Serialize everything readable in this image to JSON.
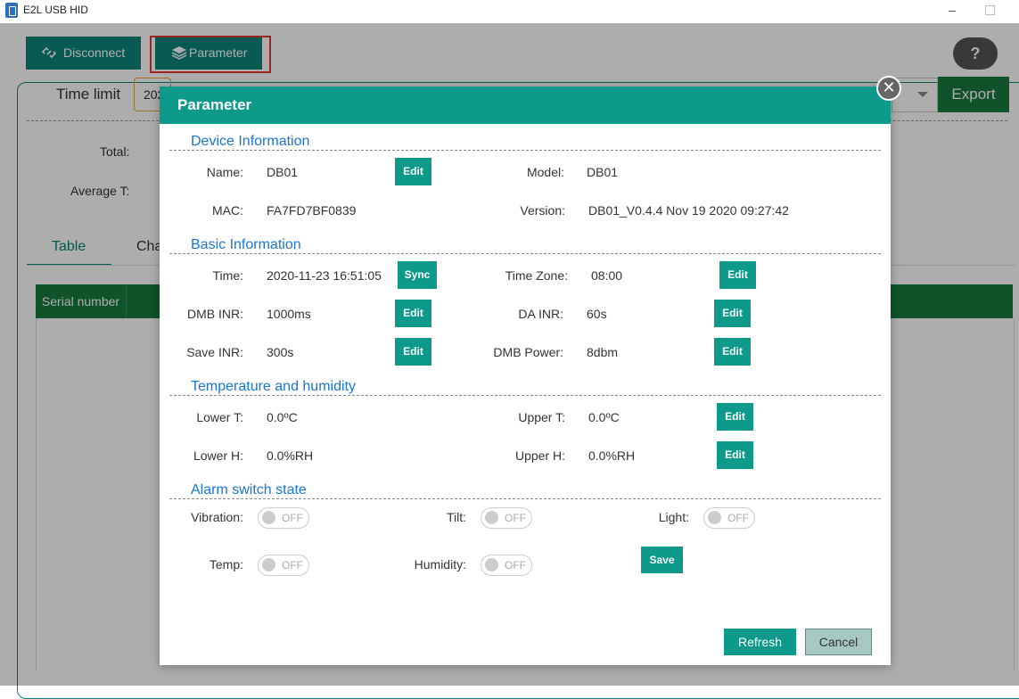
{
  "window": {
    "title": "E2L USB HID",
    "minimize": "–"
  },
  "toolbar": {
    "disconnect_label": "Disconnect",
    "parameter_label": "Parameter",
    "help_label": "?"
  },
  "filter": {
    "time_limit_label": "Time limit",
    "time_value": "202",
    "export_label": "Export"
  },
  "stats": {
    "total_label": "Total:",
    "average_label": "Average T:"
  },
  "tabs": [
    {
      "label": "Table"
    },
    {
      "label": "Cha"
    }
  ],
  "table": {
    "columns": [
      "Serial number"
    ]
  },
  "modal": {
    "title": "Parameter",
    "close_glyph": "✕",
    "device_info": {
      "title": "Device Information",
      "name_label": "Name:",
      "name_value": "DB01",
      "model_label": "Model:",
      "model_value": "DB01",
      "mac_label": "MAC:",
      "mac_value": "FA7FD7BF0839",
      "version_label": "Version:",
      "version_value": "DB01_V0.4.4 Nov 19 2020 09:27:42"
    },
    "basic_info": {
      "title": "Basic Information",
      "time_label": "Time:",
      "time_value": "2020-11-23 16:51:05",
      "timezone_label": "Time Zone:",
      "timezone_value": "08:00",
      "dmb_inr_label": "DMB INR:",
      "dmb_inr_value": "1000ms",
      "da_inr_label": "DA INR:",
      "da_inr_value": "60s",
      "save_inr_label": "Save INR:",
      "save_inr_value": "300s",
      "dmb_power_label": "DMB Power:",
      "dmb_power_value": "8dbm"
    },
    "temp_humidity": {
      "title": "Temperature and humidity",
      "lower_t_label": "Lower T:",
      "lower_t_value": "0.0ºC",
      "upper_t_label": "Upper T:",
      "upper_t_value": "0.0ºC",
      "lower_h_label": "Lower H:",
      "lower_h_value": "0.0%RH",
      "upper_h_label": "Upper H:",
      "upper_h_value": "0.0%RH"
    },
    "alarm": {
      "title": "Alarm switch state",
      "vibration_label": "Vibration:",
      "tilt_label": "Tilt:",
      "light_label": "Light:",
      "temp_label": "Temp:",
      "humidity_label": "Humidity:",
      "off_text": "OFF"
    },
    "buttons": {
      "edit": "Edit",
      "sync": "Sync",
      "save": "Save",
      "refresh": "Refresh",
      "cancel": "Cancel"
    }
  },
  "colors": {
    "accent": "#0d9a8a",
    "export_green": "#187a3e",
    "section_blue": "#1976d2",
    "highlight_red": "#e53935"
  }
}
